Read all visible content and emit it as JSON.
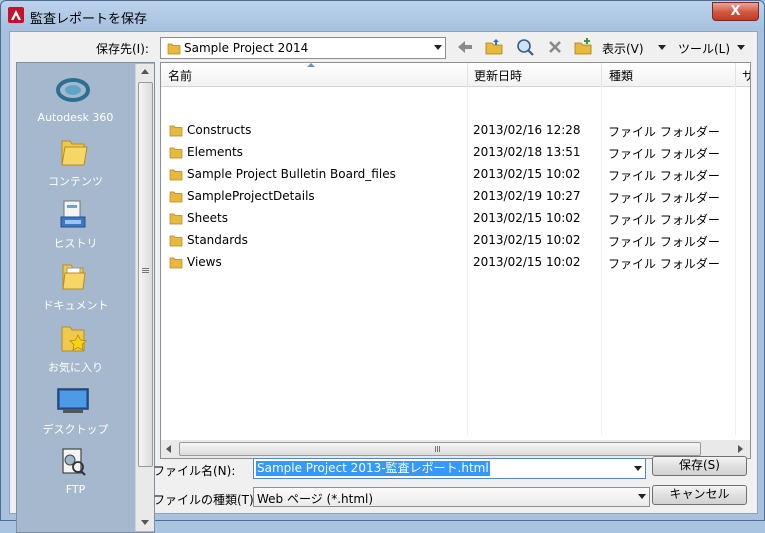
{
  "window": {
    "title": "監査レポートを保存",
    "close_label": "X"
  },
  "toolbar": {
    "save_in_label": "保存先(I):",
    "save_in_value": "Sample Project 2014",
    "view_label": "表示(V)",
    "tools_label": "ツール(L)"
  },
  "places": [
    {
      "label": "Autodesk 360",
      "icon": "autodesk-360-icon"
    },
    {
      "label": "コンテンツ",
      "icon": "folder-icon"
    },
    {
      "label": "ヒストリ",
      "icon": "history-icon"
    },
    {
      "label": "ドキュメント",
      "icon": "documents-icon"
    },
    {
      "label": "お気に入り",
      "icon": "favorites-icon"
    },
    {
      "label": "デスクトップ",
      "icon": "desktop-icon"
    },
    {
      "label": "FTP",
      "icon": "ftp-icon"
    }
  ],
  "file_list": {
    "columns": [
      "名前",
      "更新日時",
      "種類",
      "サ"
    ],
    "rows": [
      {
        "name": "Constructs",
        "date": "2013/02/16 12:28",
        "type": "ファイル フォルダー"
      },
      {
        "name": "Elements",
        "date": "2013/02/18 13:51",
        "type": "ファイル フォルダー"
      },
      {
        "name": "Sample Project Bulletin Board_files",
        "date": "2013/02/15 10:02",
        "type": "ファイル フォルダー"
      },
      {
        "name": "SampleProjectDetails",
        "date": "2013/02/19 10:27",
        "type": "ファイル フォルダー"
      },
      {
        "name": "Sheets",
        "date": "2013/02/15 10:02",
        "type": "ファイル フォルダー"
      },
      {
        "name": "Standards",
        "date": "2013/02/15 10:02",
        "type": "ファイル フォルダー"
      },
      {
        "name": "Views",
        "date": "2013/02/15 10:02",
        "type": "ファイル フォルダー"
      }
    ]
  },
  "form": {
    "filename_label": "ファイル名(N):",
    "filename_value": "Sample Project 2013-監査レポート.html",
    "filetype_label": "ファイルの種類(T):",
    "filetype_value": "Web ページ (*.html)",
    "save_button": "保存(S)",
    "cancel_button": "キャンセル"
  },
  "colors": {
    "accent": "#3399ff",
    "places_bg": "#a5b8cd",
    "close_button": "#d2553d"
  }
}
